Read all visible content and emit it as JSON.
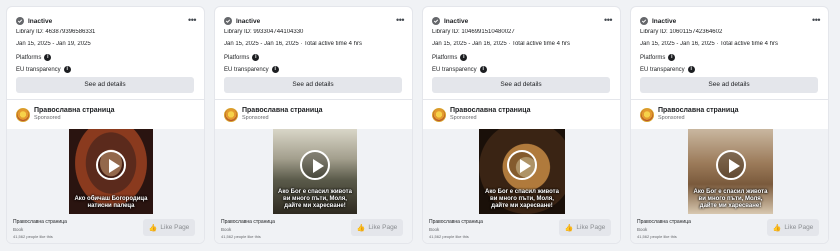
{
  "cards": [
    {
      "status": "Inactive",
      "library_id": "Library ID: 463879396586331",
      "dates": "Jan 15, 2025 - Jan 19, 2025",
      "platforms_label": "Platforms",
      "eu_label": "EU transparency",
      "details_button": "See ad details",
      "page_name": "Православна страница",
      "sponsored": "Sponsored",
      "caption": "Ако обичаш Богородица натисни палеца",
      "footer_name": "Православна страница",
      "footer_category": "Book",
      "footer_likes": "41,562 people like this",
      "like_button": "Like Page"
    },
    {
      "status": "Inactive",
      "library_id": "Library ID: 993304744104330",
      "dates": "Jan 15, 2025 - Jan 16, 2025 · Total active time 4 hrs",
      "platforms_label": "Platforms",
      "eu_label": "EU transparency",
      "details_button": "See ad details",
      "page_name": "Православна страница",
      "sponsored": "Sponsored",
      "caption": "Ако Бог е спасил живота ви много пъти, Моля, дайте ми харесване!",
      "footer_name": "Православна страница",
      "footer_category": "Book",
      "footer_likes": "41,562 people like this",
      "like_button": "Like Page"
    },
    {
      "status": "Inactive",
      "library_id": "Library ID: 1046991510480027",
      "dates": "Jan 15, 2025 - Jan 16, 2025 · Total active time 4 hrs",
      "platforms_label": "Platforms",
      "eu_label": "EU transparency",
      "details_button": "See ad details",
      "page_name": "Православна страница",
      "sponsored": "Sponsored",
      "caption": "Ако Бог е спасил живота ви много пъти, Моля, дайте ми харесване!",
      "footer_name": "Православна страница",
      "footer_category": "Book",
      "footer_likes": "41,562 people like this",
      "like_button": "Like Page"
    },
    {
      "status": "Inactive",
      "library_id": "Library ID: 1060115742364602",
      "dates": "Jan 15, 2025 - Jan 16, 2025 · Total active time 4 hrs",
      "platforms_label": "Platforms",
      "eu_label": "EU transparency",
      "details_button": "See ad details",
      "page_name": "Православна страница",
      "sponsored": "Sponsored",
      "caption": "Ако Бог е спасил живота ви много пъти, Моля, дайте ми харесване!",
      "footer_name": "Православна страница",
      "footer_category": "Book",
      "footer_likes": "41,562 people like this",
      "like_button": "Like Page"
    }
  ],
  "icons": {
    "status": "inactive-check-icon",
    "more": "more-options-icon",
    "info": "info-icon",
    "play": "play-icon",
    "like": "thumbs-up-icon"
  },
  "colors": {
    "background": "#f0f2f5",
    "card": "#ffffff",
    "button": "#e4e6eb",
    "text": "#1c1e21",
    "muted": "#65676b"
  }
}
